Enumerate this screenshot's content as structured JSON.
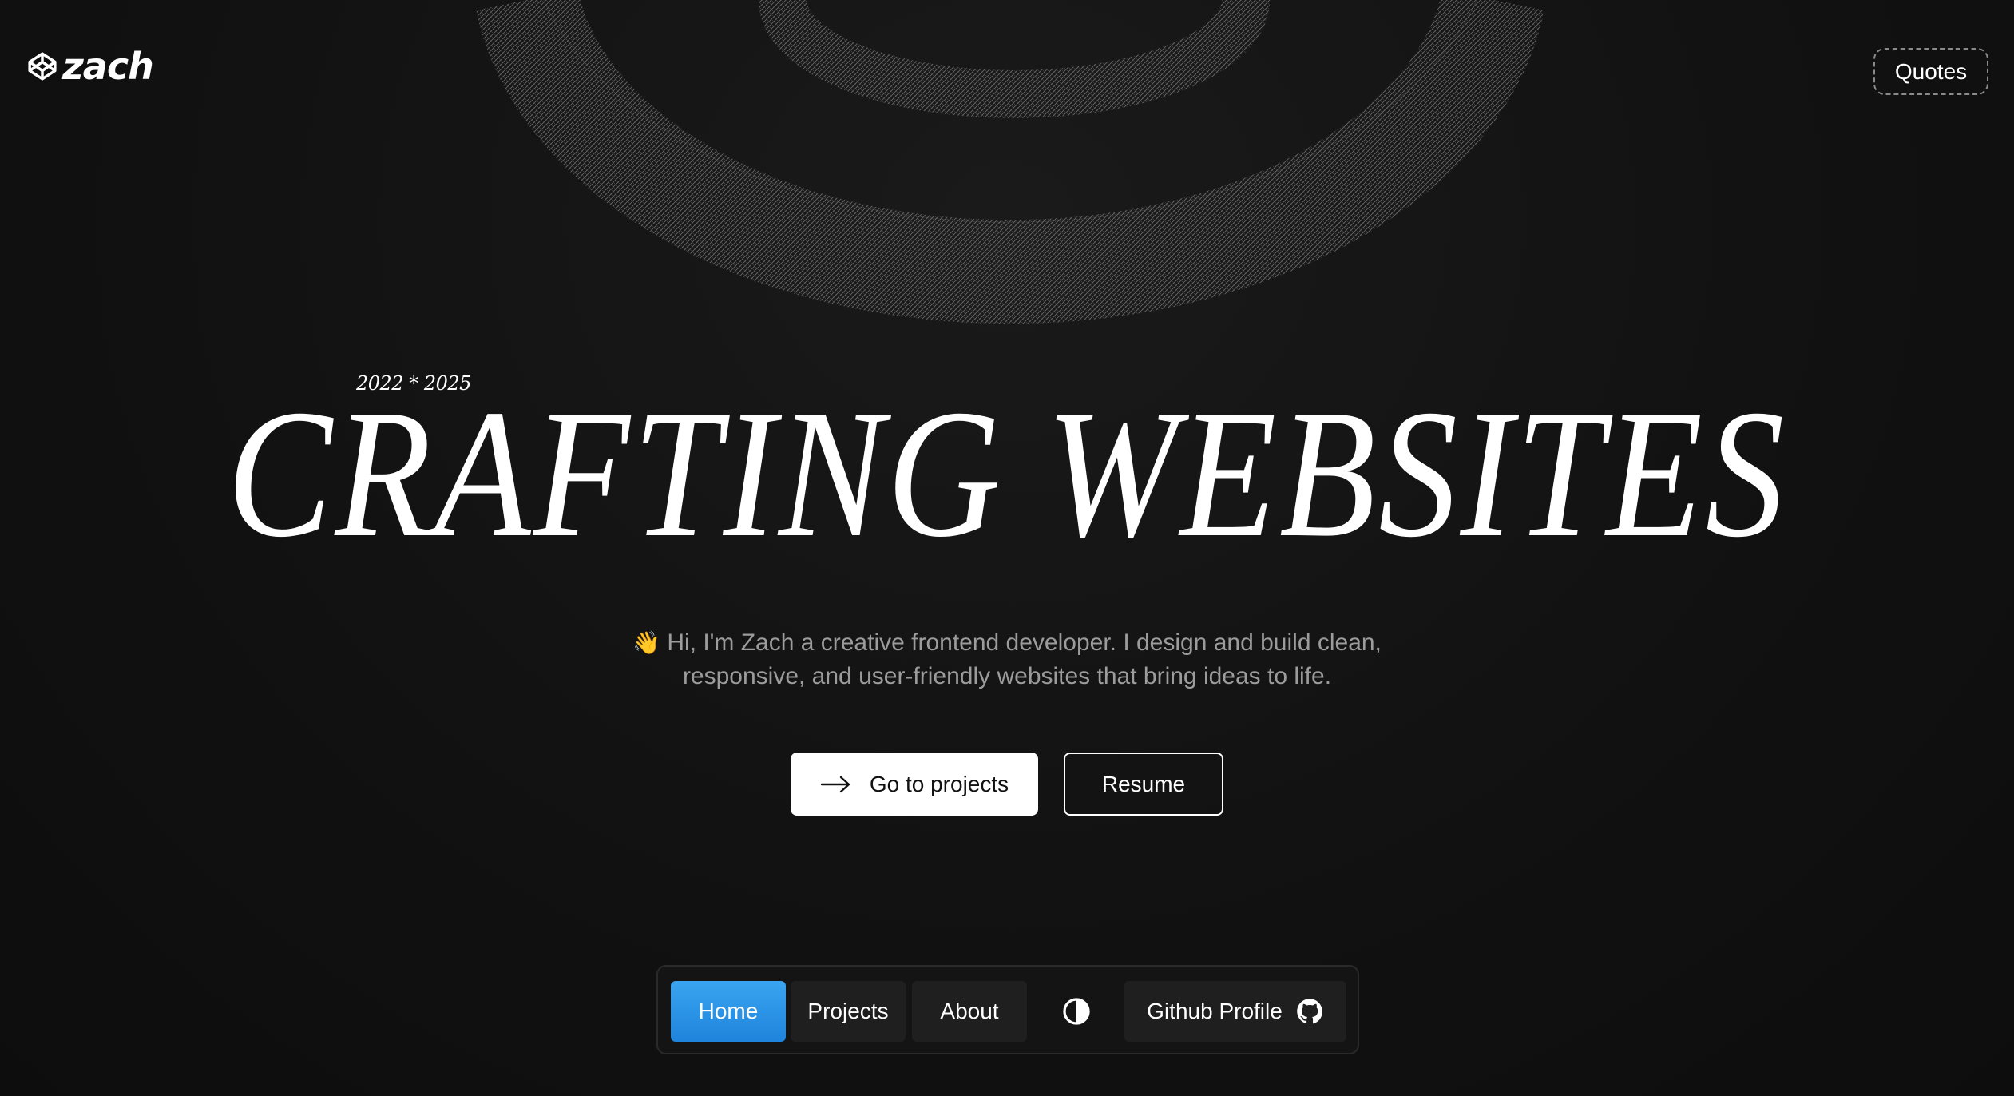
{
  "header": {
    "logo_text": "zach",
    "logo_icon": "codepen-cube-icon",
    "quotes_label": "Quotes"
  },
  "hero": {
    "years": "2022 * 2025",
    "headline": "CRAFTING WEBSITES",
    "intro_emoji": "👋",
    "intro_line1": "Hi, I'm Zach a creative frontend developer. I design and build clean,",
    "intro_line2": "responsive, and user-friendly websites that bring ideas to life.",
    "cta_label": "Go to projects",
    "cta_icon": "arrow-right-icon",
    "resume_label": "Resume"
  },
  "nav": {
    "items": [
      {
        "label": "Home",
        "active": true
      },
      {
        "label": "Projects",
        "active": false
      },
      {
        "label": "About",
        "active": false
      }
    ],
    "theme_icon": "contrast-icon",
    "github_label": "Github Profile",
    "github_icon": "github-icon"
  },
  "colors": {
    "background": "#111111",
    "text": "#ffffff",
    "muted_text": "#9c9c9c",
    "active_nav": "#2b95e6",
    "nav_item_bg": "#1f1f1f"
  }
}
